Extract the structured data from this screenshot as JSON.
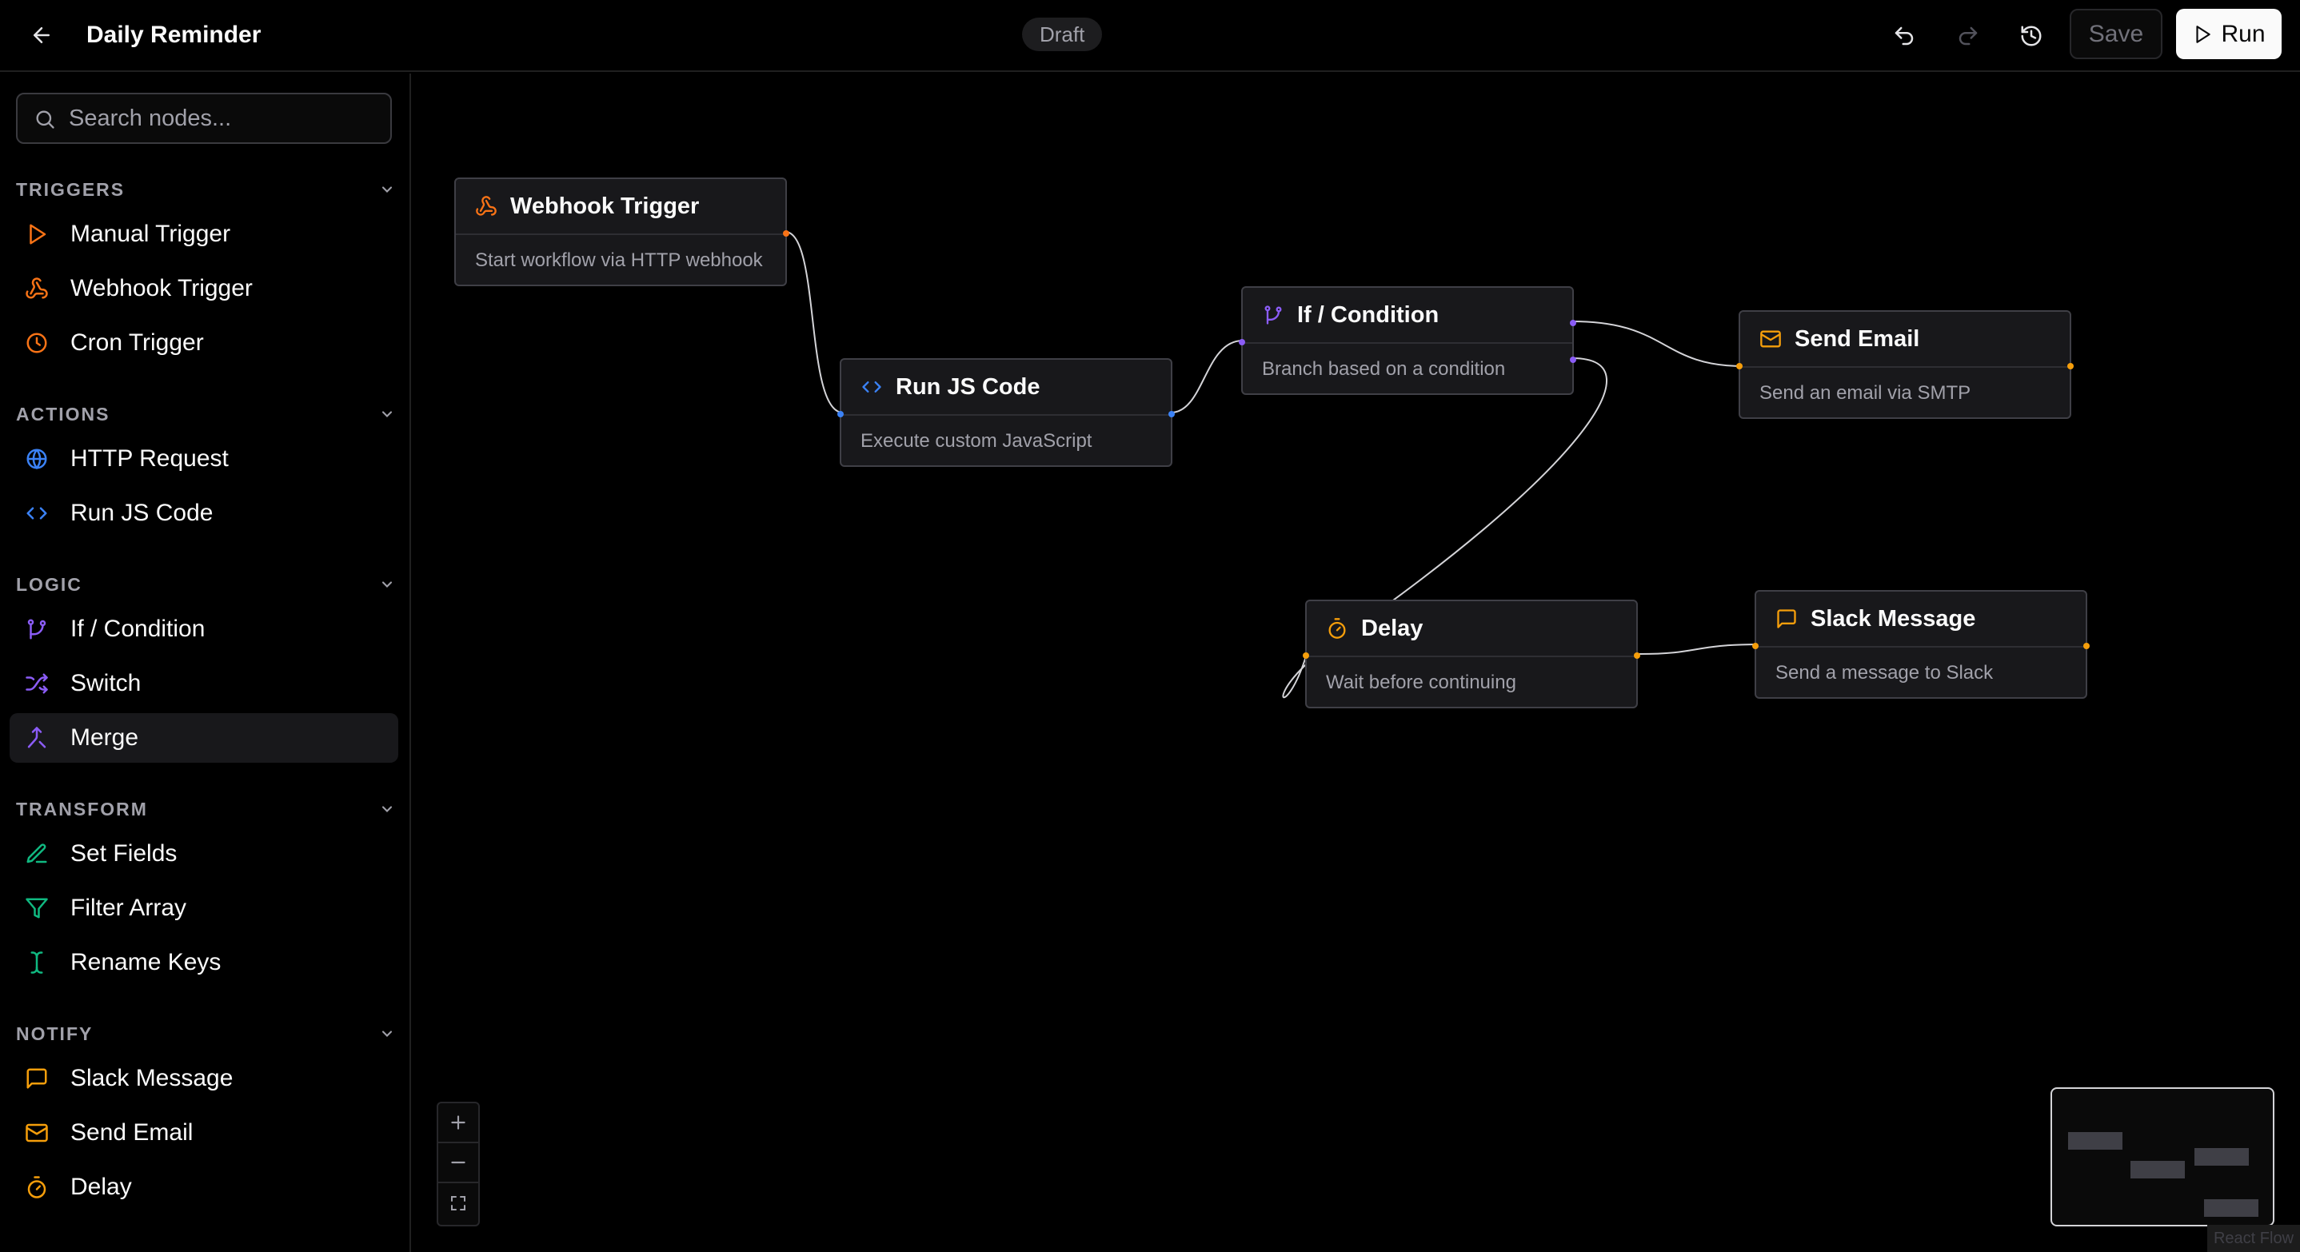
{
  "header": {
    "title": "Daily Reminder",
    "status": "Draft",
    "save_label": "Save",
    "run_label": "Run"
  },
  "sidebar": {
    "search_placeholder": "Search nodes...",
    "sections": [
      {
        "title": "TRIGGERS",
        "items": [
          {
            "label": "Manual Trigger",
            "icon": "play-icon",
            "color": "#f97316"
          },
          {
            "label": "Webhook Trigger",
            "icon": "webhook-icon",
            "color": "#f97316"
          },
          {
            "label": "Cron Trigger",
            "icon": "clock-icon",
            "color": "#f97316"
          }
        ]
      },
      {
        "title": "ACTIONS",
        "items": [
          {
            "label": "HTTP Request",
            "icon": "globe-icon",
            "color": "#3b82f6"
          },
          {
            "label": "Run JS Code",
            "icon": "code-icon",
            "color": "#3b82f6"
          }
        ]
      },
      {
        "title": "LOGIC",
        "items": [
          {
            "label": "If / Condition",
            "icon": "git-branch-icon",
            "color": "#8b5cf6"
          },
          {
            "label": "Switch",
            "icon": "shuffle-icon",
            "color": "#8b5cf6"
          },
          {
            "label": "Merge",
            "icon": "merge-icon",
            "color": "#8b5cf6"
          }
        ]
      },
      {
        "title": "TRANSFORM",
        "items": [
          {
            "label": "Set Fields",
            "icon": "pen-icon",
            "color": "#10b981"
          },
          {
            "label": "Filter Array",
            "icon": "filter-icon",
            "color": "#10b981"
          },
          {
            "label": "Rename Keys",
            "icon": "text-cursor-icon",
            "color": "#10b981"
          }
        ]
      },
      {
        "title": "NOTIFY",
        "items": [
          {
            "label": "Slack Message",
            "icon": "message-square-icon",
            "color": "#f59e0b"
          },
          {
            "label": "Send Email",
            "icon": "mail-icon",
            "color": "#f59e0b"
          },
          {
            "label": "Delay",
            "icon": "timer-icon",
            "color": "#f59e0b"
          }
        ]
      }
    ]
  },
  "canvas": {
    "nodes": [
      {
        "id": "webhook",
        "title": "Webhook Trigger",
        "desc": "Start workflow via HTTP webhook",
        "icon": "webhook-icon",
        "color": "#f97316"
      },
      {
        "id": "runjs",
        "title": "Run JS Code",
        "desc": "Execute custom JavaScript",
        "icon": "code-icon",
        "color": "#3b82f6"
      },
      {
        "id": "ifcond",
        "title": "If / Condition",
        "desc": "Branch based on a condition",
        "icon": "git-branch-icon",
        "color": "#8b5cf6"
      },
      {
        "id": "email",
        "title": "Send Email",
        "desc": "Send an email via SMTP",
        "icon": "mail-icon",
        "color": "#f59e0b"
      },
      {
        "id": "delay",
        "title": "Delay",
        "desc": "Wait before continuing",
        "icon": "timer-icon",
        "color": "#f59e0b"
      },
      {
        "id": "slack",
        "title": "Slack Message",
        "desc": "Send a message to Slack",
        "icon": "message-square-icon",
        "color": "#f59e0b"
      }
    ],
    "attribution": "React Flow"
  }
}
